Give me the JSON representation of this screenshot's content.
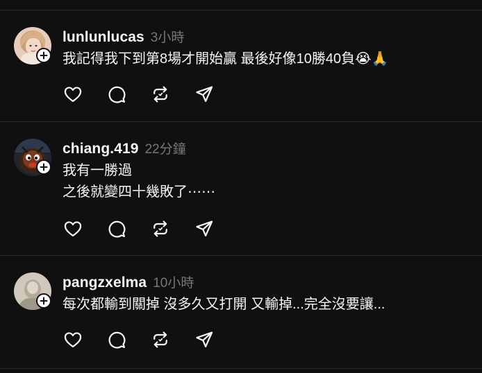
{
  "posts": [
    {
      "username": "lunlunlucas",
      "timestamp": "3小時",
      "lines": [
        "我記得我下到第8場才開始贏 最後好像10勝40負😭🙏"
      ],
      "avatar_icon": "avatar-photo-blonde-woman"
    },
    {
      "username": "chiang.419",
      "timestamp": "22分鐘",
      "lines": [
        "我有一勝過",
        "之後就變四十幾敗了⋯⋯"
      ],
      "avatar_icon": "avatar-photo-dark-character"
    },
    {
      "username": "pangzxelma",
      "timestamp": "10小時",
      "lines": [
        "每次都輸到關掉 沒多久又打開 又輸掉...完全沒要讓..."
      ],
      "avatar_icon": "avatar-photo-faded-portrait"
    }
  ],
  "actions": [
    "heart-icon",
    "comment-icon",
    "repost-icon",
    "share-icon"
  ],
  "colors": {
    "background": "#101010",
    "text": "#f3f5f7",
    "muted": "#777777",
    "divider": "#2e2e2e",
    "icon": "#f3f5f7"
  }
}
